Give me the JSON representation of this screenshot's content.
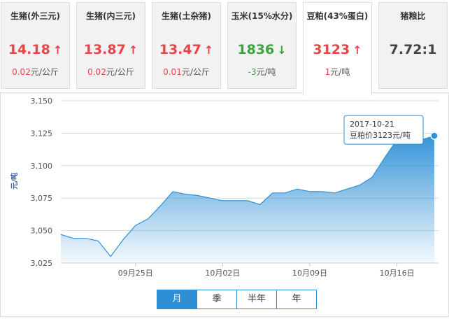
{
  "cards": [
    {
      "title": "生猪(外三元)",
      "value": "14.18",
      "arrow": "↑",
      "trend": "up",
      "change_num": "0.02",
      "change_unit": "元/公斤"
    },
    {
      "title": "生猪(内三元)",
      "value": "13.87",
      "arrow": "↑",
      "trend": "up",
      "change_num": "0.02",
      "change_unit": "元/公斤"
    },
    {
      "title": "生猪(土杂猪)",
      "value": "13.47",
      "arrow": "↑",
      "trend": "up",
      "change_num": "0.01",
      "change_unit": "元/公斤"
    },
    {
      "title": "玉米(15%水分)",
      "value": "1836",
      "arrow": "↓",
      "trend": "down",
      "change_num": "-3",
      "change_unit": "元/吨"
    },
    {
      "title": "豆粕(43%蛋白)",
      "value": "3123",
      "arrow": "↑",
      "trend": "up",
      "change_num": "1",
      "change_unit": "元/吨"
    },
    {
      "title": "猪粮比",
      "value": "7.72:1",
      "arrow": "",
      "trend": "neutral",
      "change_num": "",
      "change_unit": ""
    }
  ],
  "colors": {
    "up": "#e5464a",
    "down": "#3aa53a",
    "accent": "#2d8fd6",
    "area_top": "#2d8fd6"
  },
  "tabs": [
    {
      "label": "月",
      "active": true
    },
    {
      "label": "季",
      "active": false
    },
    {
      "label": "半年",
      "active": false
    },
    {
      "label": "年",
      "active": false
    }
  ],
  "tooltip": {
    "date": "2017-10-21",
    "text": "豆粕价3123元/吨"
  },
  "chart_data": {
    "type": "area",
    "ylabel": "元/吨",
    "ylim": [
      3025,
      3150
    ],
    "yticks": [
      3025,
      3050,
      3075,
      3100,
      3125,
      3150
    ],
    "ytick_labels": [
      "3,025",
      "3,050",
      "3,075",
      "3,100",
      "3,125",
      "3,150"
    ],
    "xtick_labels": [
      {
        "index": 6,
        "label": "09月25日"
      },
      {
        "index": 13,
        "label": "10月02日"
      },
      {
        "index": 20,
        "label": "10月09日"
      },
      {
        "index": 27,
        "label": "10月16日"
      }
    ],
    "x": [
      "09-21",
      "09-22",
      "09-23",
      "09-24",
      "09-25",
      "09-26",
      "09-27",
      "09-28",
      "09-29",
      "09-30",
      "10-01",
      "10-02",
      "10-03",
      "10-04",
      "10-05",
      "10-06",
      "10-07",
      "10-08",
      "10-09",
      "10-10",
      "10-11",
      "10-12",
      "10-13",
      "10-14",
      "10-15",
      "10-16",
      "10-17",
      "10-18",
      "10-19",
      "10-20",
      "10-21"
    ],
    "series": [
      {
        "name": "豆粕价",
        "values": [
          3047,
          3044,
          3044,
          3042,
          3030,
          3043,
          3054,
          3059,
          3069,
          3080,
          3078,
          3077,
          3075,
          3073,
          3073,
          3073,
          3070,
          3079,
          3079,
          3082,
          3080,
          3080,
          3079,
          3082,
          3085,
          3091,
          3106,
          3120,
          3120,
          3120,
          3123
        ]
      }
    ]
  }
}
